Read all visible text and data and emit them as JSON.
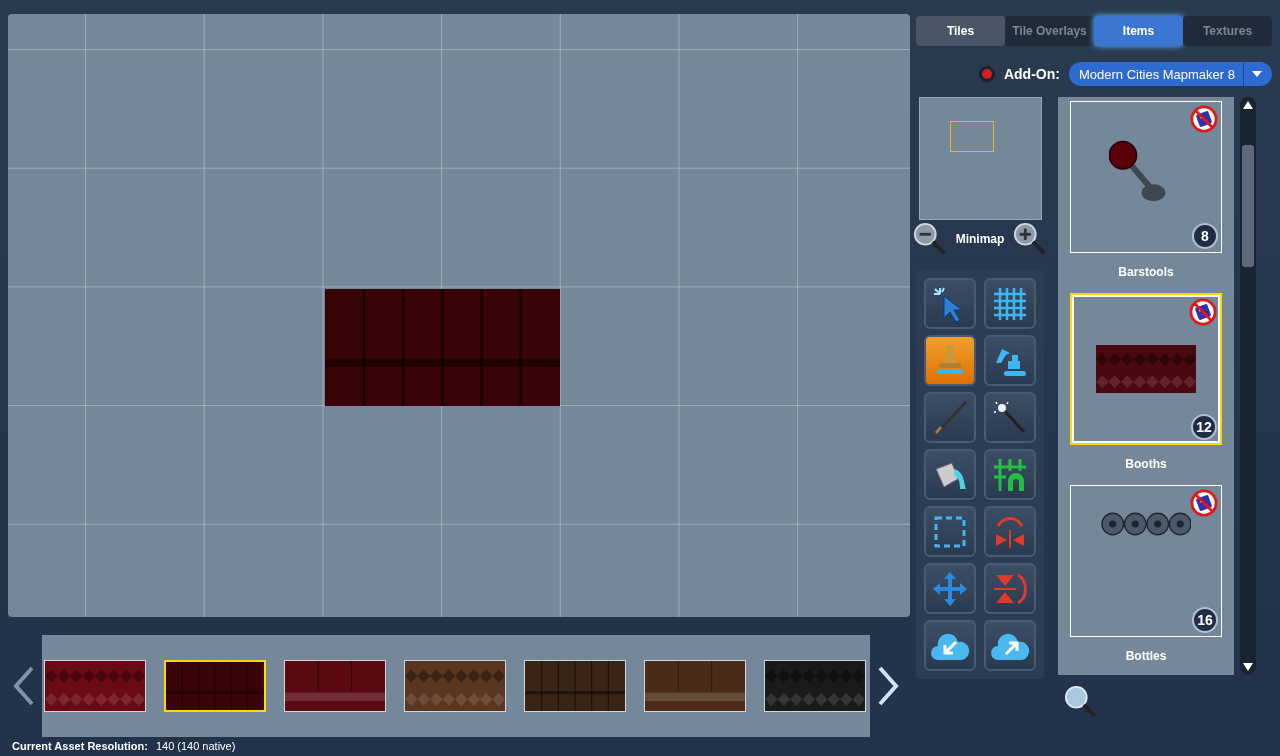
{
  "tabs": [
    {
      "label": "Tiles",
      "selected": false,
      "disabled": false
    },
    {
      "label": "Tile Overlays",
      "selected": false,
      "disabled": true
    },
    {
      "label": "Items",
      "selected": true,
      "disabled": false
    },
    {
      "label": "Textures",
      "selected": false,
      "disabled": true
    }
  ],
  "addon": {
    "label": "Add-On:",
    "value": "Modern Cities Mapmaker 8"
  },
  "minimap": {
    "label": "Minimap"
  },
  "tools": [
    {
      "kind": "select",
      "selected": false
    },
    {
      "kind": "grid",
      "selected": false
    },
    {
      "kind": "stamp",
      "selected": true
    },
    {
      "kind": "excavator",
      "selected": false
    },
    {
      "kind": "brush",
      "selected": false
    },
    {
      "kind": "wand",
      "selected": false
    },
    {
      "kind": "bucket",
      "selected": false
    },
    {
      "kind": "gridarch",
      "selected": false
    },
    {
      "kind": "marquee",
      "selected": false
    },
    {
      "kind": "fliph",
      "selected": false
    },
    {
      "kind": "move",
      "selected": false
    },
    {
      "kind": "flipv",
      "selected": false
    },
    {
      "kind": "import",
      "selected": false
    },
    {
      "kind": "export",
      "selected": false
    }
  ],
  "items": [
    {
      "kind": "barstool",
      "label": "Barstools",
      "count": "8",
      "selected": false
    },
    {
      "kind": "booth",
      "label": "Booths",
      "count": "12",
      "selected": true
    },
    {
      "kind": "bottles",
      "label": "Bottles",
      "count": "16",
      "selected": false
    }
  ],
  "variants": [
    {
      "kind": "tufted",
      "color": "#6a0a14",
      "selected": false
    },
    {
      "kind": "panel",
      "color": "#3a0508",
      "selected": true
    },
    {
      "kind": "star",
      "color": "#5a0a10",
      "selected": false
    },
    {
      "kind": "tufted",
      "color": "#5a3520",
      "selected": false
    },
    {
      "kind": "panel",
      "color": "#3a2415",
      "selected": false
    },
    {
      "kind": "star",
      "color": "#4a2c18",
      "selected": false
    },
    {
      "kind": "tufted",
      "color": "#1a1a1a",
      "selected": false
    }
  ],
  "status": {
    "label": "Current Asset Resolution:",
    "value": "140 (140 native)"
  }
}
